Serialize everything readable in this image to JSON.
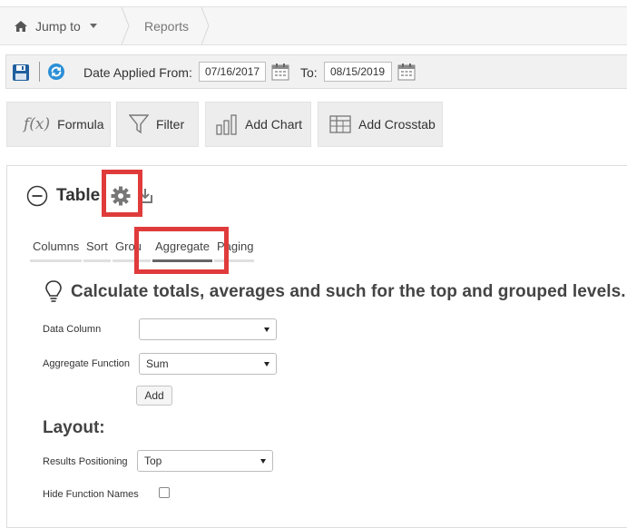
{
  "breadcrumb": {
    "jump_to": "Jump to",
    "reports": "Reports"
  },
  "datebar": {
    "date_applied_from_label": "Date Applied From:",
    "date_from_value": "07/16/2017",
    "to_label": "To:",
    "date_to_value": "08/15/2019"
  },
  "toolbar": {
    "formula_label": "Formula",
    "formula_icon_text": "f(x)",
    "filter_label": "Filter",
    "add_chart_label": "Add Chart",
    "add_crosstab_label": "Add Crosstab"
  },
  "panel": {
    "title": "Table",
    "tabs": [
      {
        "label": "Columns"
      },
      {
        "label": "Sort"
      },
      {
        "label": "Grou"
      },
      {
        "label": "Aggregate",
        "active": true
      },
      {
        "label": "Paging"
      }
    ],
    "heading": "Calculate totals, averages and such for the top and grouped levels.",
    "data_column_label": "Data Column",
    "data_column_value": "",
    "aggregate_function_label": "Aggregate Function",
    "aggregate_function_value": "Sum",
    "add_button_label": "Add",
    "layout_heading": "Layout:",
    "results_positioning_label": "Results Positioning",
    "results_positioning_value": "Top",
    "hide_function_names_label": "Hide Function Names",
    "hide_function_names_checked": false
  },
  "colors": {
    "highlight": "#e03b3b",
    "active_tab_underline": "#666666",
    "icon_blue": "#1f5f9e",
    "refresh_blue": "#2b8fd6"
  },
  "icons": {
    "home": "home-icon",
    "caret": "caret-down-icon",
    "save": "save-icon",
    "refresh": "refresh-icon",
    "calendar": "calendar-icon",
    "filter": "funnel-icon",
    "chart": "bar-chart-icon",
    "crosstab": "grid-icon",
    "collapse": "minus-circle-icon",
    "gear": "gear-icon",
    "export": "export-icon",
    "bulb": "lightbulb-icon"
  }
}
